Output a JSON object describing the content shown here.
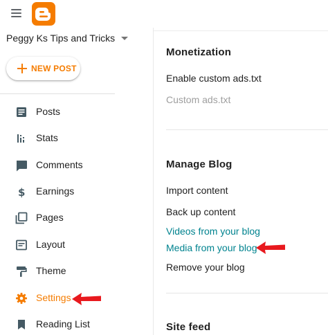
{
  "app": {
    "menu_icon": "hamburger-menu-icon",
    "logo_icon": "blogger-logo-icon",
    "brand_color": "#f57c00",
    "blog_name": "Peggy Ks Tips and Tricks",
    "new_post_label": "NEW POST"
  },
  "sidebar": {
    "items": [
      {
        "label": "Posts",
        "icon": "posts-icon"
      },
      {
        "label": "Stats",
        "icon": "stats-icon"
      },
      {
        "label": "Comments",
        "icon": "comments-icon"
      },
      {
        "label": "Earnings",
        "icon": "dollar-icon"
      },
      {
        "label": "Pages",
        "icon": "pages-icon"
      },
      {
        "label": "Layout",
        "icon": "layout-icon"
      },
      {
        "label": "Theme",
        "icon": "theme-icon"
      },
      {
        "label": "Settings",
        "icon": "gear-icon",
        "active": true
      },
      {
        "label": "Reading List",
        "icon": "bookmark-icon"
      }
    ]
  },
  "main": {
    "monetization": {
      "title": "Monetization",
      "enable_custom_ads": "Enable custom ads.txt",
      "custom_ads": "Custom ads.txt"
    },
    "manage_blog": {
      "title": "Manage Blog",
      "import_content": "Import content",
      "back_up_content": "Back up content",
      "videos_from_blog": "Videos from your blog",
      "media_from_blog": "Media from your blog",
      "remove_blog": "Remove your blog"
    },
    "site_feed": {
      "title": "Site feed"
    }
  },
  "annotations": {
    "arrow_color": "#e8191e"
  }
}
